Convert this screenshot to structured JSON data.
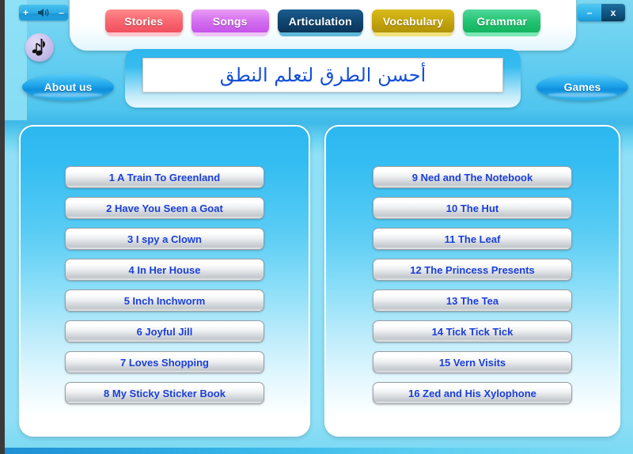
{
  "window": {
    "title_arabic": "أحسن الطرق لتعلم النطق",
    "minimize_label": "–",
    "close_label": "x"
  },
  "volume": {
    "increase_label": "+",
    "decrease_label": "–",
    "speaker_icon": "speaker-icon"
  },
  "music_note": {
    "icon": "music-note-icon"
  },
  "tabs": [
    {
      "label": "Stories",
      "key": "stories",
      "color": "#f9666f",
      "active": false
    },
    {
      "label": "Songs",
      "key": "songs",
      "color": "#d46ef0",
      "active": false
    },
    {
      "label": "Articulation",
      "key": "articulation",
      "color": "#0f4570",
      "active": true
    },
    {
      "label": "Vocabulary",
      "key": "vocabulary",
      "color": "#c4a50d",
      "active": false
    },
    {
      "label": "Grammar",
      "key": "grammar",
      "color": "#22c471",
      "active": false
    }
  ],
  "side_buttons": {
    "about": "About us",
    "games": "Games"
  },
  "panels": {
    "left": {
      "items": [
        "1 A Train To Greenland",
        "2 Have You Seen a Goat",
        "3 I spy a Clown",
        "4 In Her House",
        "5 Inch Inchworm",
        "6 Joyful Jill",
        "7 Loves Shopping",
        "8 My Sticky Sticker Book"
      ]
    },
    "right": {
      "items": [
        "9 Ned and The Notebook",
        "10 The Hut",
        "11 The Leaf",
        "12 The Princess Presents",
        "13 The Tea",
        "14 Tick Tick Tick",
        "15 Vern Visits",
        "16 Zed and His Xylophone"
      ]
    }
  },
  "colors": {
    "background_blue": "#62cdf0",
    "item_text": "#1b3fd8",
    "title_text": "#1450d8"
  }
}
